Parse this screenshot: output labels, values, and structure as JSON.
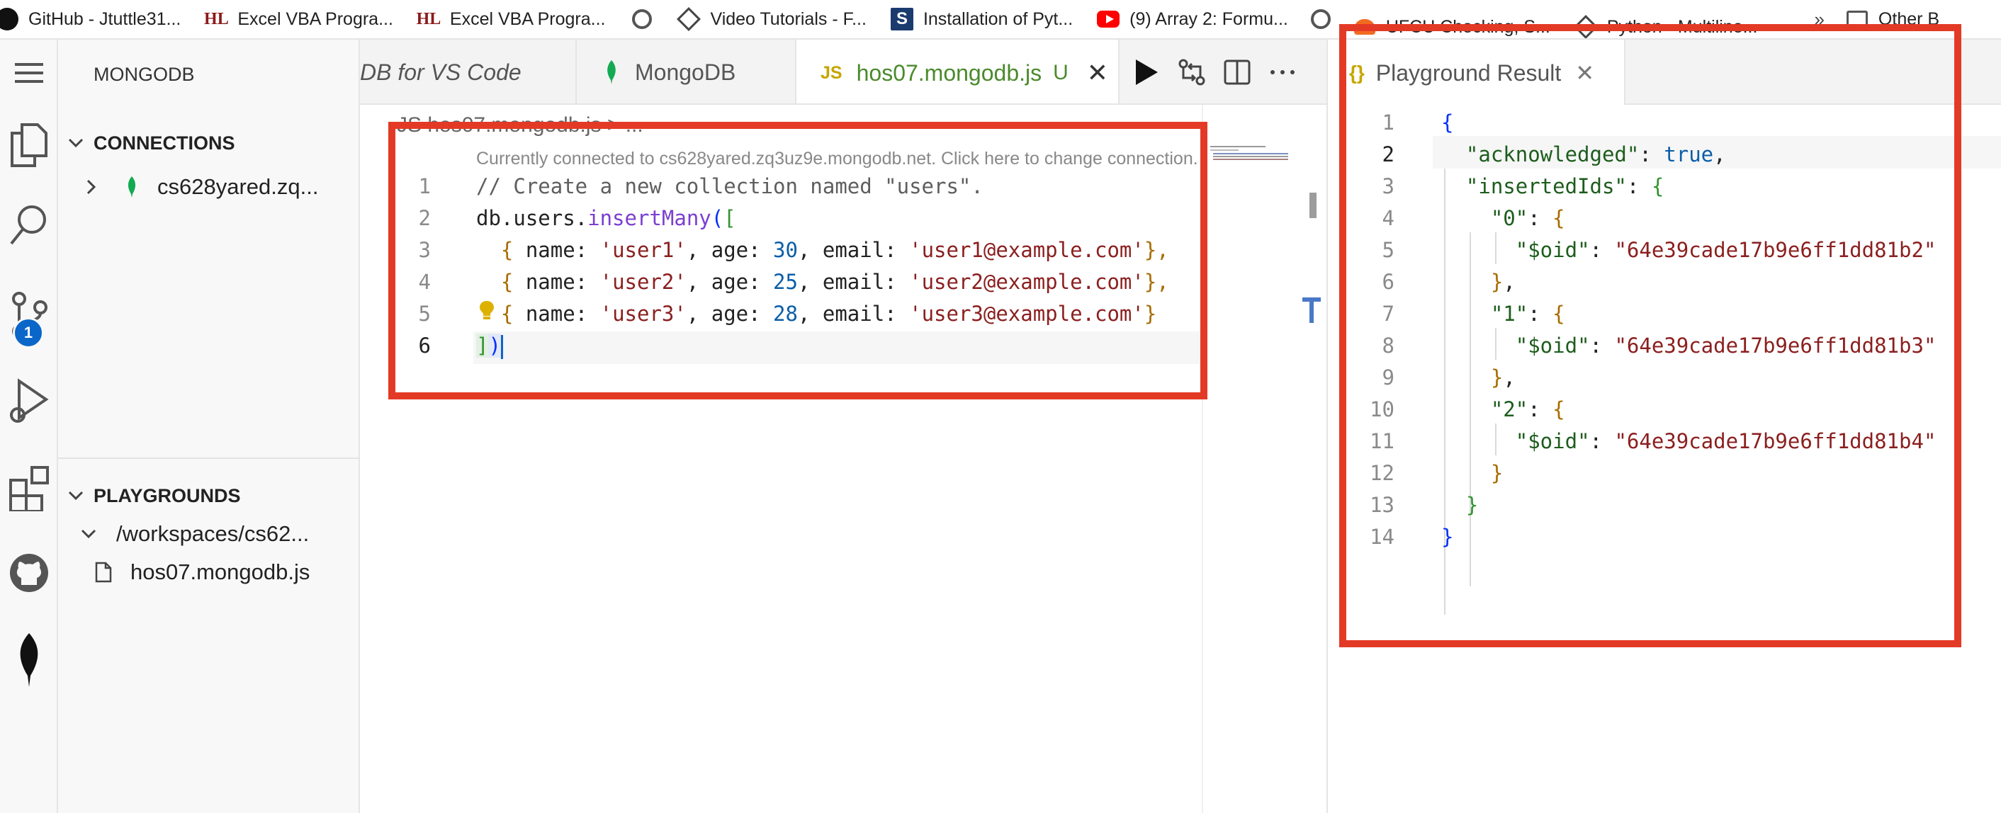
{
  "bookmarks": [
    {
      "icon": "github-icon",
      "label": "GitHub - Jtuttle31..."
    },
    {
      "icon": "hl-icon",
      "label": "Excel VBA Progra..."
    },
    {
      "icon": "hl-icon",
      "label": "Excel VBA Progra..."
    },
    {
      "icon": "globe-icon",
      "label": ""
    },
    {
      "icon": "diamond-icon",
      "label": "Video Tutorials - F..."
    },
    {
      "icon": "s-icon",
      "label": "Installation of Pyt..."
    },
    {
      "icon": "youtube-icon",
      "label": "(9) Array 2: Formu..."
    },
    {
      "icon": "globe-icon",
      "label": ""
    },
    {
      "icon": "ufcu-icon",
      "label": "UFCU Checking, S..."
    },
    {
      "icon": "diamond-icon",
      "label": "Python - Multiline..."
    },
    {
      "icon": "chevron-icon",
      "label": "»"
    },
    {
      "icon": "folder-icon",
      "label": "Other B"
    }
  ],
  "activity": {
    "source_control_badge": "1"
  },
  "sidebar": {
    "title": "MONGODB",
    "connections_header": "CONNECTIONS",
    "connection_item": "cs628yared.zq...",
    "playgrounds_header": "PLAYGROUNDS",
    "workspace_folder": "/workspaces/cs62...",
    "playground_file": "hos07.mongodb.js"
  },
  "editor": {
    "tabs": [
      {
        "label": "DB for VS Code"
      },
      {
        "label": "MongoDB"
      },
      {
        "js_badge": "JS",
        "label": "hos07.mongodb.js",
        "status": "U",
        "close": "✕"
      }
    ],
    "breadcrumb": "JS hos07.mongodb.js > ...",
    "codelens": "Currently connected to cs628yared.zq3uz9e.mongodb.net. Click here to change connection.",
    "line_numbers": [
      "1",
      "2",
      "3",
      "4",
      "5",
      "6"
    ],
    "code": {
      "l1": "// Create a new collection named \"users\".",
      "l2_obj": "db.users.",
      "l2_fn": "insertMany",
      "l2_p": "(",
      "l2_b": "[",
      "users": [
        {
          "name": "'user1'",
          "age": "30",
          "email": "'user1@example.com'",
          "end": "},"
        },
        {
          "name": "'user2'",
          "age": "25",
          "email": "'user2@example.com'",
          "end": "},"
        },
        {
          "name": "'user3'",
          "age": "28",
          "email": "'user3@example.com'",
          "end": "}"
        }
      ],
      "l6_b": "]",
      "l6_p": ")"
    }
  },
  "result": {
    "tab_icon": "{}",
    "tab_label": "Playground Result",
    "close": "✕",
    "line_numbers": [
      "1",
      "2",
      "3",
      "4",
      "5",
      "6",
      "7",
      "8",
      "9",
      "10",
      "11",
      "12",
      "13",
      "14"
    ],
    "acknowledged_key": "\"acknowledged\"",
    "acknowledged_value": "true",
    "inserted_key": "\"insertedIds\"",
    "ids": [
      {
        "key": "\"0\"",
        "oid_key": "\"$oid\"",
        "oid": "\"64e39cade17b9e6ff1dd81b2\""
      },
      {
        "key": "\"1\"",
        "oid_key": "\"$oid\"",
        "oid": "\"64e39cade17b9e6ff1dd81b3\""
      },
      {
        "key": "\"2\"",
        "oid_key": "\"$oid\"",
        "oid": "\"64e39cade17b9e6ff1dd81b4\""
      }
    ]
  }
}
